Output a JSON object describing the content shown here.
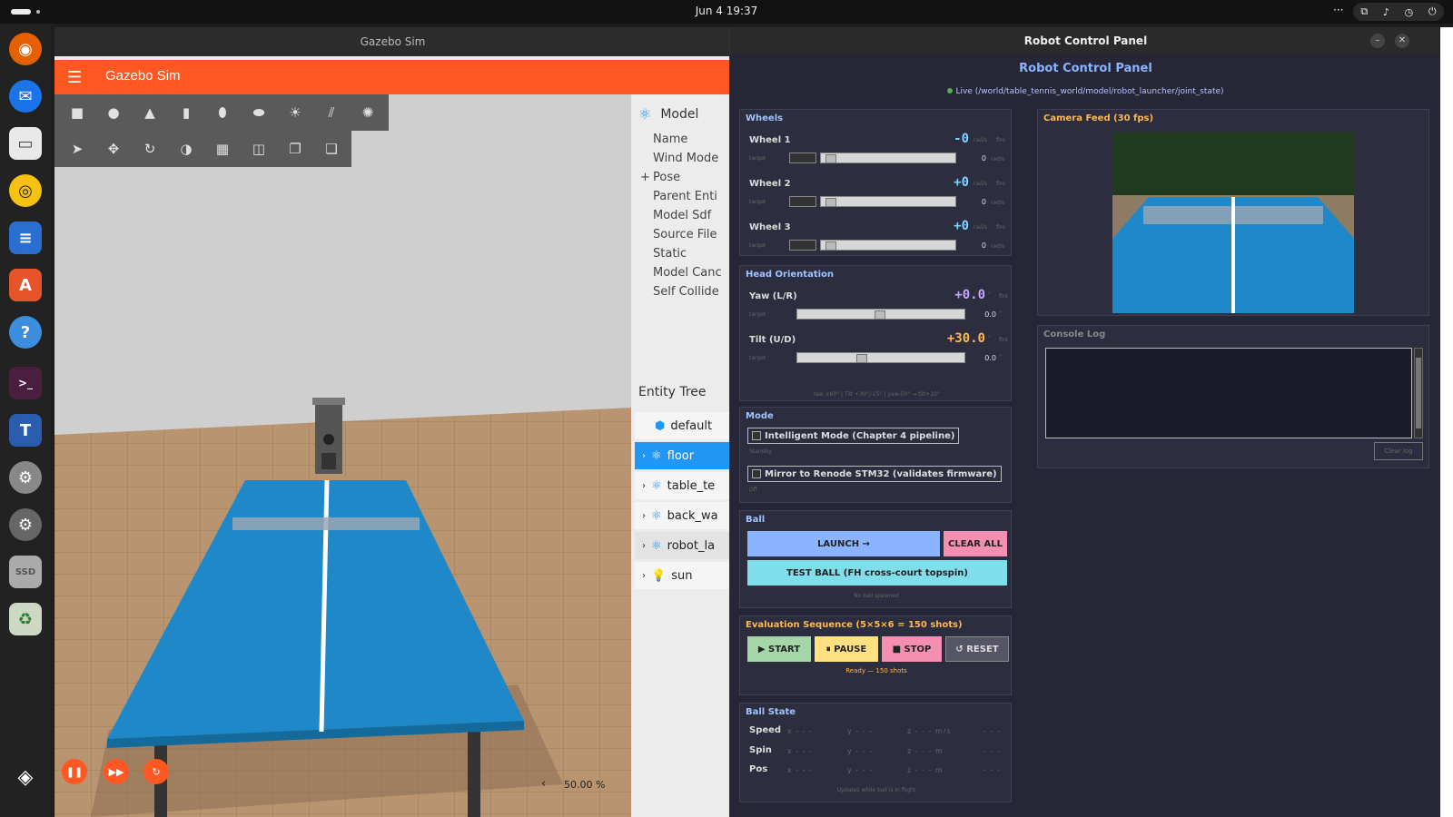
{
  "topbar": {
    "clock": "Jun 4  19:37",
    "more": "···"
  },
  "dock": [
    "firefox-icon",
    "thunderbird-icon",
    "files-icon",
    "rhythmbox-icon",
    "writer-icon",
    "app-center-icon",
    "help-icon",
    "terminal-icon",
    "text-editor-icon",
    "settings-icon",
    "settings-icon",
    "ssd-drive-icon",
    "trash-icon",
    "show-apps-icon"
  ],
  "dock_ssd_label": "SSD",
  "gazebo": {
    "window_title": "Gazebo Sim",
    "header_title": "Gazebo Sim",
    "component_header": "Model",
    "components": [
      "Name",
      "Wind Mode",
      "Pose",
      "Parent Enti",
      "Model Sdf",
      "Source File",
      "Static",
      "Model Canc",
      "Self Collide"
    ],
    "entity_tree_title": "Entity Tree",
    "entities": [
      "default",
      "floor",
      "table_te",
      "back_wa",
      "robot_la",
      "sun"
    ],
    "zoom": "50.00 %",
    "zoom_arrow": "‹"
  },
  "rcp": {
    "window_title": "Robot Control Panel",
    "heading": "Robot Control Panel",
    "status": "Live  (/world/table_tennis_world/model/robot_launcher/joint_state)",
    "wheels": {
      "title": "Wheels",
      "unit": "rad/s",
      "fire_label": "fire",
      "target_label": "target",
      "items": [
        {
          "label": "Wheel 1",
          "value": "-0",
          "target": "0",
          "level": 0.04
        },
        {
          "label": "Wheel 2",
          "value": "+0",
          "target": "0",
          "level": 0.04
        },
        {
          "label": "Wheel 3",
          "value": "+0",
          "target": "0",
          "level": 0.04
        }
      ]
    },
    "head": {
      "title": "Head Orientation",
      "fire_label": "fire",
      "target_label": "target",
      "unit": "°",
      "items": [
        {
          "label": "Yaw  (L/R)",
          "value": "+0.0",
          "target": "0.0",
          "level": 0.5,
          "color": "#c4a3ff"
        },
        {
          "label": "Tilt (U/D)",
          "value": "+30.0",
          "target": "0.0",
          "level": 0.38,
          "color": "#ffb84d"
        }
      ],
      "hint": "Yaw ±60°  |  Tilt +30°/-15°  |  yaw-50° → tilt+10°"
    },
    "mode": {
      "title": "Mode",
      "intelligent": "Intelligent Mode  (Chapter 4 pipeline)",
      "intelligent_state": "Standby",
      "mirror": "Mirror to Renode STM32  (validates firmware)",
      "mirror_state": "Off"
    },
    "ball": {
      "title": "Ball",
      "launch": "LAUNCH →",
      "clear": "CLEAR ALL",
      "test": "TEST BALL  (FH cross-court topspin)",
      "status": "No ball spawned"
    },
    "evaluation": {
      "title": "Evaluation Sequence (5×5×6 = 150 shots)",
      "start": "▶  START",
      "pause": "⏸  PAUSE",
      "stop": "■  STOP",
      "reset": "↺  RESET",
      "status": "Ready — 150 shots"
    },
    "ball_state": {
      "title": "Ball State",
      "rows": [
        {
          "label": "Speed",
          "a": "x  - - -",
          "b": "y  - - -",
          "c": "z  - - -  m/s",
          "d": "- - -"
        },
        {
          "label": "Spin",
          "a": "x  - - -",
          "b": "y  - - -",
          "c": "z  - - -  m",
          "d": "- - -"
        },
        {
          "label": "Pos",
          "a": "x  - - -",
          "b": "y  - - -",
          "c": "z  - - -  m",
          "d": "- - -"
        }
      ],
      "footer": "Updates while ball is in flight"
    },
    "camera": {
      "title": "Camera Feed  (30 fps)"
    },
    "console": {
      "title": "Console Log",
      "clear": "Clear log"
    }
  },
  "colors": {
    "gazebo_orange": "#ff5722",
    "table_blue": "#1e88c9",
    "selected_blue": "#2196f3",
    "launch_blue": "#8ab4ff",
    "clear_pink": "#f48fb1",
    "test_teal": "#80deea",
    "start_green": "#a5d6a7",
    "pause_yellow": "#ffe082",
    "stop_pink": "#f48fb1",
    "reset_grey": "#555566"
  }
}
